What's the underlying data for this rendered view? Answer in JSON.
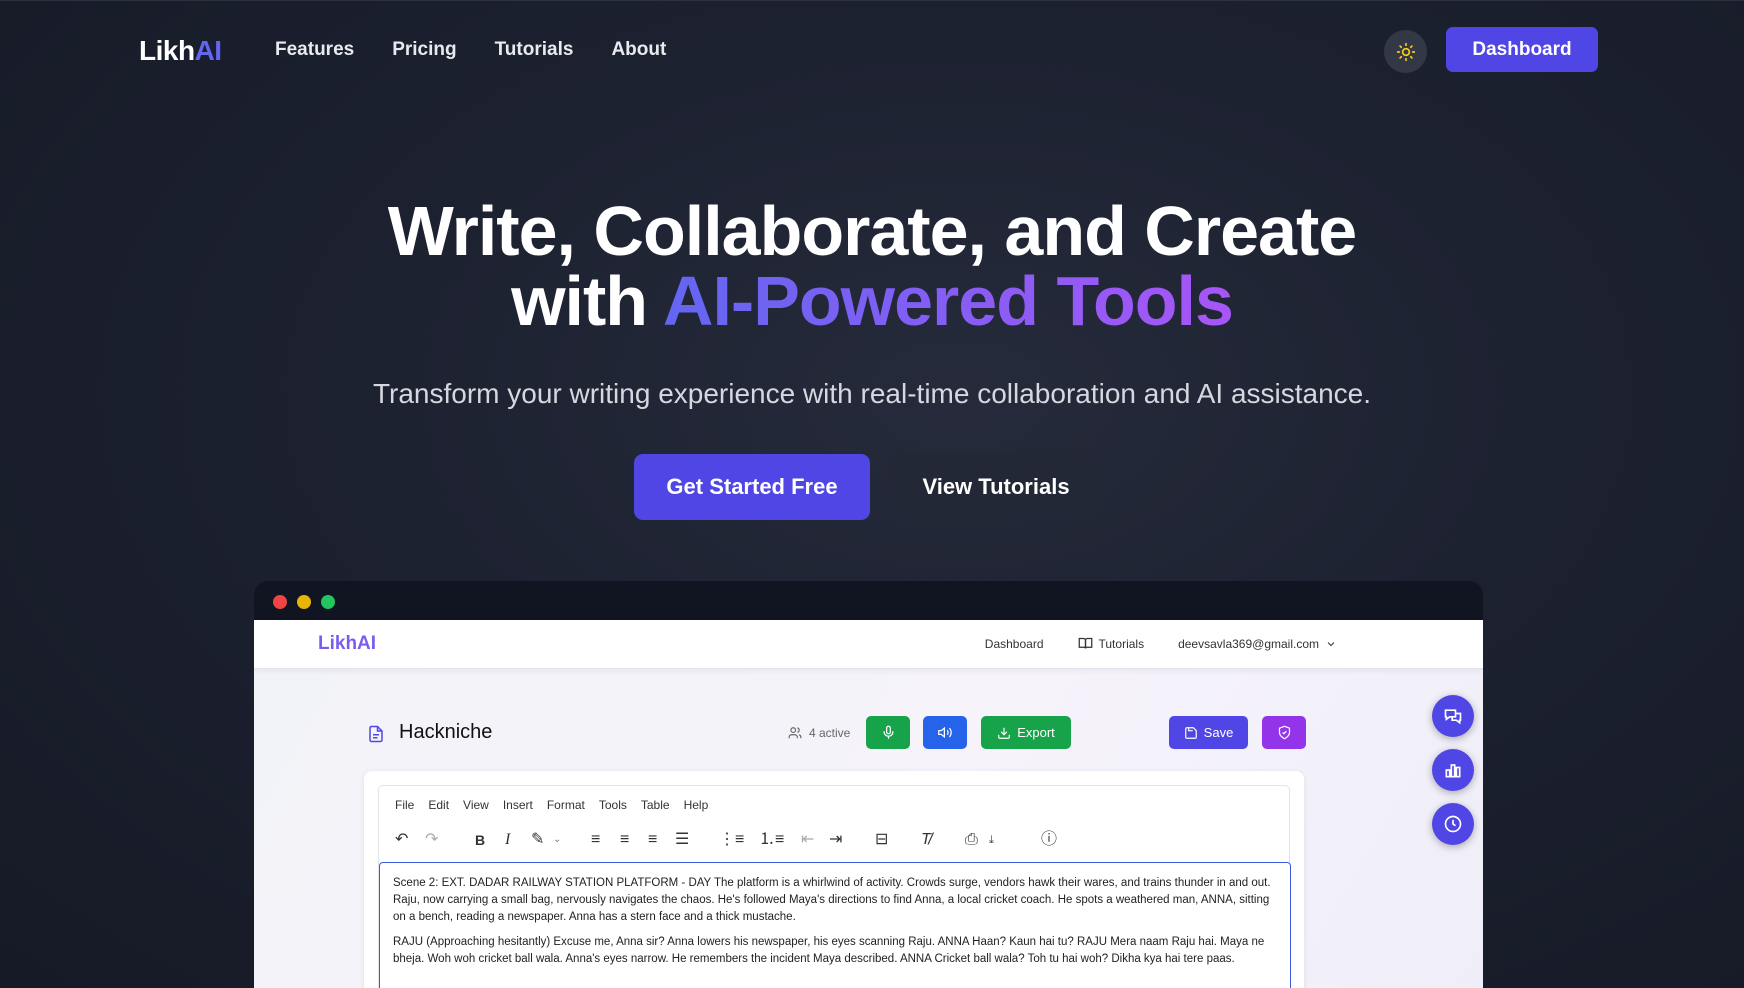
{
  "nav": {
    "logo_main": "Likh",
    "logo_accent": "AI",
    "links": [
      "Features",
      "Pricing",
      "Tutorials",
      "About"
    ],
    "theme_icon": "sun-icon",
    "dashboard_label": "Dashboard"
  },
  "hero": {
    "title_line1": "Write, Collaborate, and Create",
    "title_line2_plain": "with",
    "title_line2_gradient": "AI-Powered Tools",
    "subtitle": "Transform your writing experience with real-time collaboration and AI assistance.",
    "cta_primary": "Get Started Free",
    "cta_secondary": "View Tutorials"
  },
  "preview": {
    "window_dots": [
      "#ef4444",
      "#eab308",
      "#22c55e"
    ],
    "app_logo": "LikhAI",
    "app_nav": {
      "dashboard": "Dashboard",
      "tutorials": "Tutorials",
      "user_email": "deevsavla369@gmail.com"
    },
    "doc_title": "Hackniche",
    "active_count": "4 active",
    "export_label": "Export",
    "save_label": "Save",
    "menu": [
      "File",
      "Edit",
      "View",
      "Insert",
      "Format",
      "Tools",
      "Table",
      "Help"
    ],
    "content": {
      "para1": "Scene 2:  EXT. DADAR RAILWAY STATION PLATFORM - DAY  The platform is a whirlwind of activity. Crowds surge, vendors hawk their wares, and trains thunder in and out. Raju, now carrying a small bag, nervously navigates the chaos. He's followed Maya's directions to find Anna, a local cricket coach.  He spots a weathered man, ANNA, sitting on a bench, reading a newspaper. Anna has a stern face and a thick mustache.",
      "para2": "RAJU (Approaching hesitantly) Excuse me, Anna sir?  Anna lowers his newspaper, his eyes scanning Raju.  ANNA Haan? Kaun hai tu?  RAJU Mera naam Raju hai. Maya ne bheja. Woh  woh cricket ball wala.  Anna's eyes narrow. He remembers the incident Maya described.  ANNA Cricket ball wala? Toh tu hai woh? Dikha kya hai tere paas."
    }
  },
  "colors": {
    "accent": "#4f46e5",
    "gradient_start": "#6366f1",
    "gradient_end": "#a855f7",
    "green": "#16a34a",
    "blue": "#2563eb",
    "purple": "#9333ea"
  }
}
